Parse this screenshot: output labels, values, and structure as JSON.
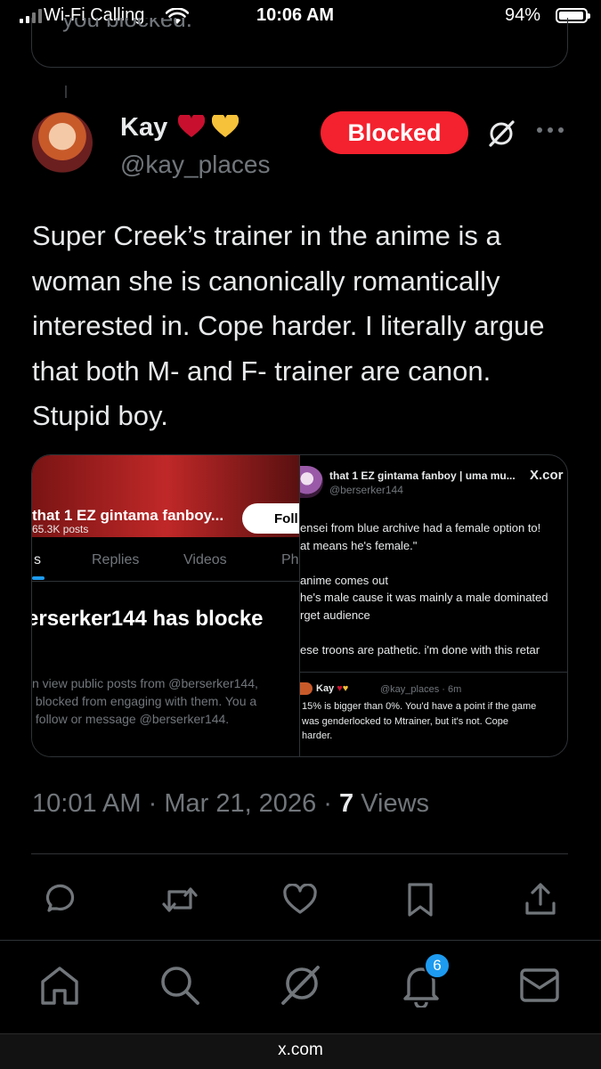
{
  "status_bar": {
    "carrier": "Wi-Fi Calling",
    "time": "10:06 AM",
    "battery": "94%",
    "battery_level": 0.94
  },
  "previous_tweet": {
    "partial_text": "you blocked."
  },
  "tweet": {
    "author_name": "Kay",
    "name_emojis": [
      "❤️",
      "💛"
    ],
    "handle": "@kay_places",
    "blocked_label": "Blocked",
    "text": "Super Creek’s trainer in the anime is a woman she is canonically romantically interested in. Cope harder. I literally argue that both M- and F- trainer are canon. Stupid boy.",
    "time": "10:01 AM",
    "date": "Mar 21, 2026",
    "views_count": "7",
    "views_label": "Views"
  },
  "media": {
    "left": {
      "profile_title": "that 1 EZ gintama fanboy...",
      "posts_count": "65.3K posts",
      "follow_label": "Foll",
      "tabs": [
        "s",
        "Replies",
        "Videos",
        "Ph"
      ],
      "blocked_heading": "erserker144 has blocke",
      "info_text": "n view public posts from @berserker144,\n blocked from engaging with them. You a\n follow or message @berserker144."
    },
    "right": {
      "author": "that 1 EZ gintama fanboy | uma mu...",
      "x_label": "X.cor",
      "handle": "@berserker144",
      "body": "ensei from blue archive had a female option to!\nat means he's female.\"\n\nanime comes out\nhe's male cause it was mainly a male dominated\nrget audience\n\nese troons are pathetic. i'm done with this retar",
      "reply_name": "Kay",
      "reply_meta": "@kay_places · 6m",
      "reply_body": "15% is bigger than 0%. You'd have a point if the game\nwas genderlocked to Mtrainer, but it's not. Cope\nharder."
    }
  },
  "actions": [
    "reply-icon",
    "retweet-icon",
    "like-icon",
    "bookmark-icon",
    "share-icon"
  ],
  "bottom_nav": {
    "items": [
      "home-icon",
      "search-icon",
      "grok-icon",
      "notifications-icon",
      "messages-icon"
    ],
    "notification_badge": "6"
  },
  "browser": {
    "url": "x.com"
  },
  "colors": {
    "background": "#000000",
    "blocked_red": "#f4212e",
    "accent_blue": "#1d9bf0",
    "muted_text": "#71767b",
    "primary_text": "#e7e9ea"
  }
}
